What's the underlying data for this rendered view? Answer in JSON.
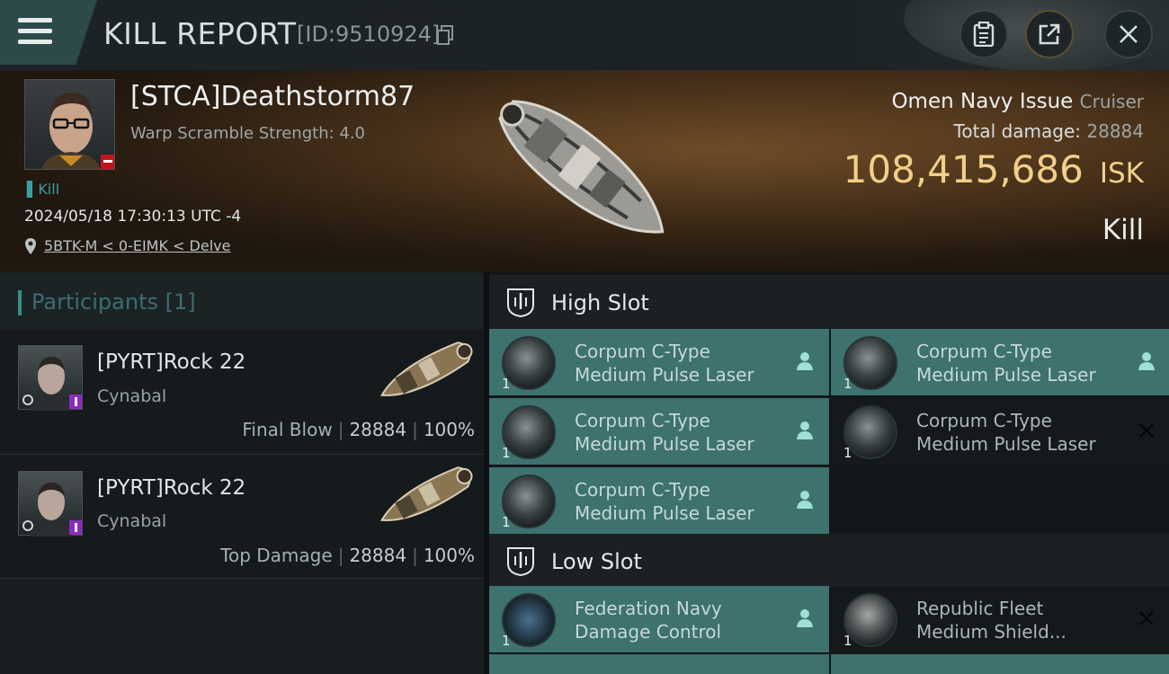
{
  "header": {
    "title": "KILL REPORT",
    "report_id": "[ID:9510924]",
    "menu_icon": "hamburger-menu-icon",
    "buttons": [
      "clipboard-icon",
      "share-icon",
      "close-icon"
    ]
  },
  "victim": {
    "name": "[STCA]Deathstorm87",
    "warp_scramble": "Warp Scramble Strength: 4.0",
    "kill_tag": "Kill",
    "datetime": "2024/05/18 17:30:13 UTC -4",
    "location": "5BTK-M < 0-EIMK < Delve"
  },
  "ship": {
    "name": "Omen Navy Issue",
    "class": "Cruiser",
    "total_damage_label": "Total damage:",
    "total_damage": "28884",
    "isk_value": "108,415,686",
    "isk_unit": "ISK",
    "result": "Kill"
  },
  "participants": {
    "title": "Participants",
    "count": "[1]",
    "rows": [
      {
        "name": "[PYRT]Rock 22",
        "ship": "Cynabal",
        "label": "Final Blow",
        "damage": "28884",
        "percent": "100%"
      },
      {
        "name": "[PYRT]Rock 22",
        "ship": "Cynabal",
        "label": "Top Damage",
        "damage": "28884",
        "percent": "100%"
      }
    ]
  },
  "slots": {
    "high": {
      "title": "High Slot",
      "modules": [
        {
          "name1": "Corpum C-Type",
          "name2": "Medium Pulse Laser",
          "qty": "1",
          "status": "dropped"
        },
        {
          "name1": "Corpum C-Type",
          "name2": "Medium Pulse Laser",
          "qty": "1",
          "status": "dropped"
        },
        {
          "name1": "Corpum C-Type",
          "name2": "Medium Pulse Laser",
          "qty": "1",
          "status": "dropped"
        },
        {
          "name1": "Corpum C-Type",
          "name2": "Medium Pulse Laser",
          "qty": "1",
          "status": "destroyed"
        },
        {
          "name1": "Corpum C-Type",
          "name2": "Medium Pulse Laser",
          "qty": "1",
          "status": "dropped"
        }
      ]
    },
    "low": {
      "title": "Low Slot",
      "modules": [
        {
          "name1": "Federation Navy",
          "name2": "Damage Control",
          "qty": "1",
          "status": "dropped"
        },
        {
          "name1": "Republic Fleet",
          "name2": "Medium Shield...",
          "qty": "1",
          "status": "destroyed"
        }
      ]
    }
  },
  "colors": {
    "accent": "#3aa1a0",
    "isk": "#f1cf8a",
    "dropped_row": "#3d726e",
    "destroyed_row": "#14191b"
  }
}
